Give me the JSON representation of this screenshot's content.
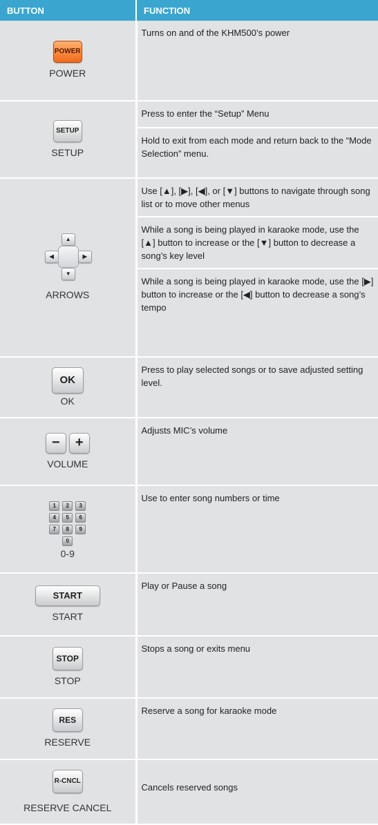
{
  "header": {
    "button_col": "BUTTON",
    "function_col": "FUNCTION"
  },
  "rows": [
    {
      "key_text": "POWER",
      "label": "POWER",
      "functions": [
        "Turns on and of the KHM500’s power"
      ]
    },
    {
      "key_text": "SETUP",
      "label": "SETUP",
      "functions": [
        "Press to enter the “Setup” Menu",
        "Hold to exit from each mode and return back to the “Mode Selection” menu."
      ]
    },
    {
      "arrow_up": "▲",
      "arrow_down": "▼",
      "arrow_left": "◀",
      "arrow_right": "▶",
      "label": "ARROWS",
      "functions": [
        "Use [▲], [▶], [◀], or [▼]  buttons to navigate through song list or to move other menus",
        "While a song is being played in karaoke mode, use the [▲] button to increase or the [▼] button to decrease a song’s key level",
        "While a song is being played in karaoke mode, use the [▶] button to increase or the [◀] button to decrease a song’s tempo"
      ]
    },
    {
      "key_text": "OK",
      "label": "OK",
      "functions": [
        "Press to play selected songs or to save adjusted setting level."
      ]
    },
    {
      "minus": "−",
      "plus": "+",
      "label": "VOLUME",
      "functions": [
        "Adjusts MIC’s volume"
      ]
    },
    {
      "digits": [
        "1",
        "2",
        "3",
        "4",
        "5",
        "6",
        "7",
        "8",
        "9",
        "0"
      ],
      "label": "0-9",
      "functions": [
        "Use to enter song numbers or time"
      ]
    },
    {
      "key_text": "START",
      "label": "START",
      "functions": [
        "Play or Pause a song"
      ]
    },
    {
      "key_text": "STOP",
      "label": "STOP",
      "functions": [
        "Stops a song or exits menu"
      ]
    },
    {
      "key_text": "RES",
      "label": "RESERVE",
      "functions": [
        "Reserve a song for karaoke mode"
      ]
    },
    {
      "key_text": "R-CNCL",
      "label": "RESERVE CANCEL",
      "functions": [
        "Cancels reserved songs"
      ]
    }
  ],
  "colors": {
    "header_bg": "#3aa6cf",
    "cell_bg": "#e1e2e4",
    "power_key": "#f06a1a"
  }
}
